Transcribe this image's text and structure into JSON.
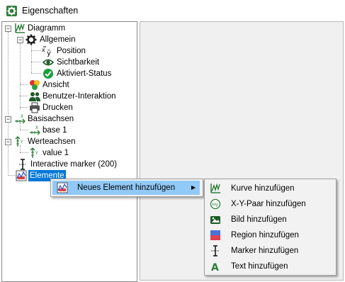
{
  "window": {
    "title": "Eigenschaften"
  },
  "tree": {
    "diagramm": "Diagramm",
    "allgemein": "Allgemein",
    "position": "Position",
    "sichtbarkeit": "Sichtbarkeit",
    "aktiviert_status": "Aktiviert-Status",
    "ansicht": "Ansicht",
    "benutzer_interaktion": "Benutzer-Interaktion",
    "drucken": "Drucken",
    "basisachsen": "Basisachsen",
    "base1": "base 1",
    "werteachsen": "Werteachsen",
    "value1": "value 1",
    "interactive_marker": "Interactive marker (200)",
    "elemente": "Elemente"
  },
  "context_menu": {
    "neues_element": "Neues Element hinzufügen",
    "submenu_arrow": "▶"
  },
  "submenu": {
    "items": [
      {
        "label": "Kurve hinzufügen",
        "icon": "curve-icon"
      },
      {
        "label": "X-Y-Paar hinzufügen",
        "icon": "xy-pair-icon"
      },
      {
        "label": "Bild hinzufügen",
        "icon": "image-icon"
      },
      {
        "label": "Region hinzufügen",
        "icon": "region-icon"
      },
      {
        "label": "Marker hinzufügen",
        "icon": "marker-icon"
      },
      {
        "label": "Text hinzufügen",
        "icon": "text-icon"
      }
    ]
  },
  "colors": {
    "selection": "#0078d7",
    "menu_highlight": "#91c9f7",
    "check_green": "#1a9e3c",
    "brand_green": "#2f7d3a"
  }
}
